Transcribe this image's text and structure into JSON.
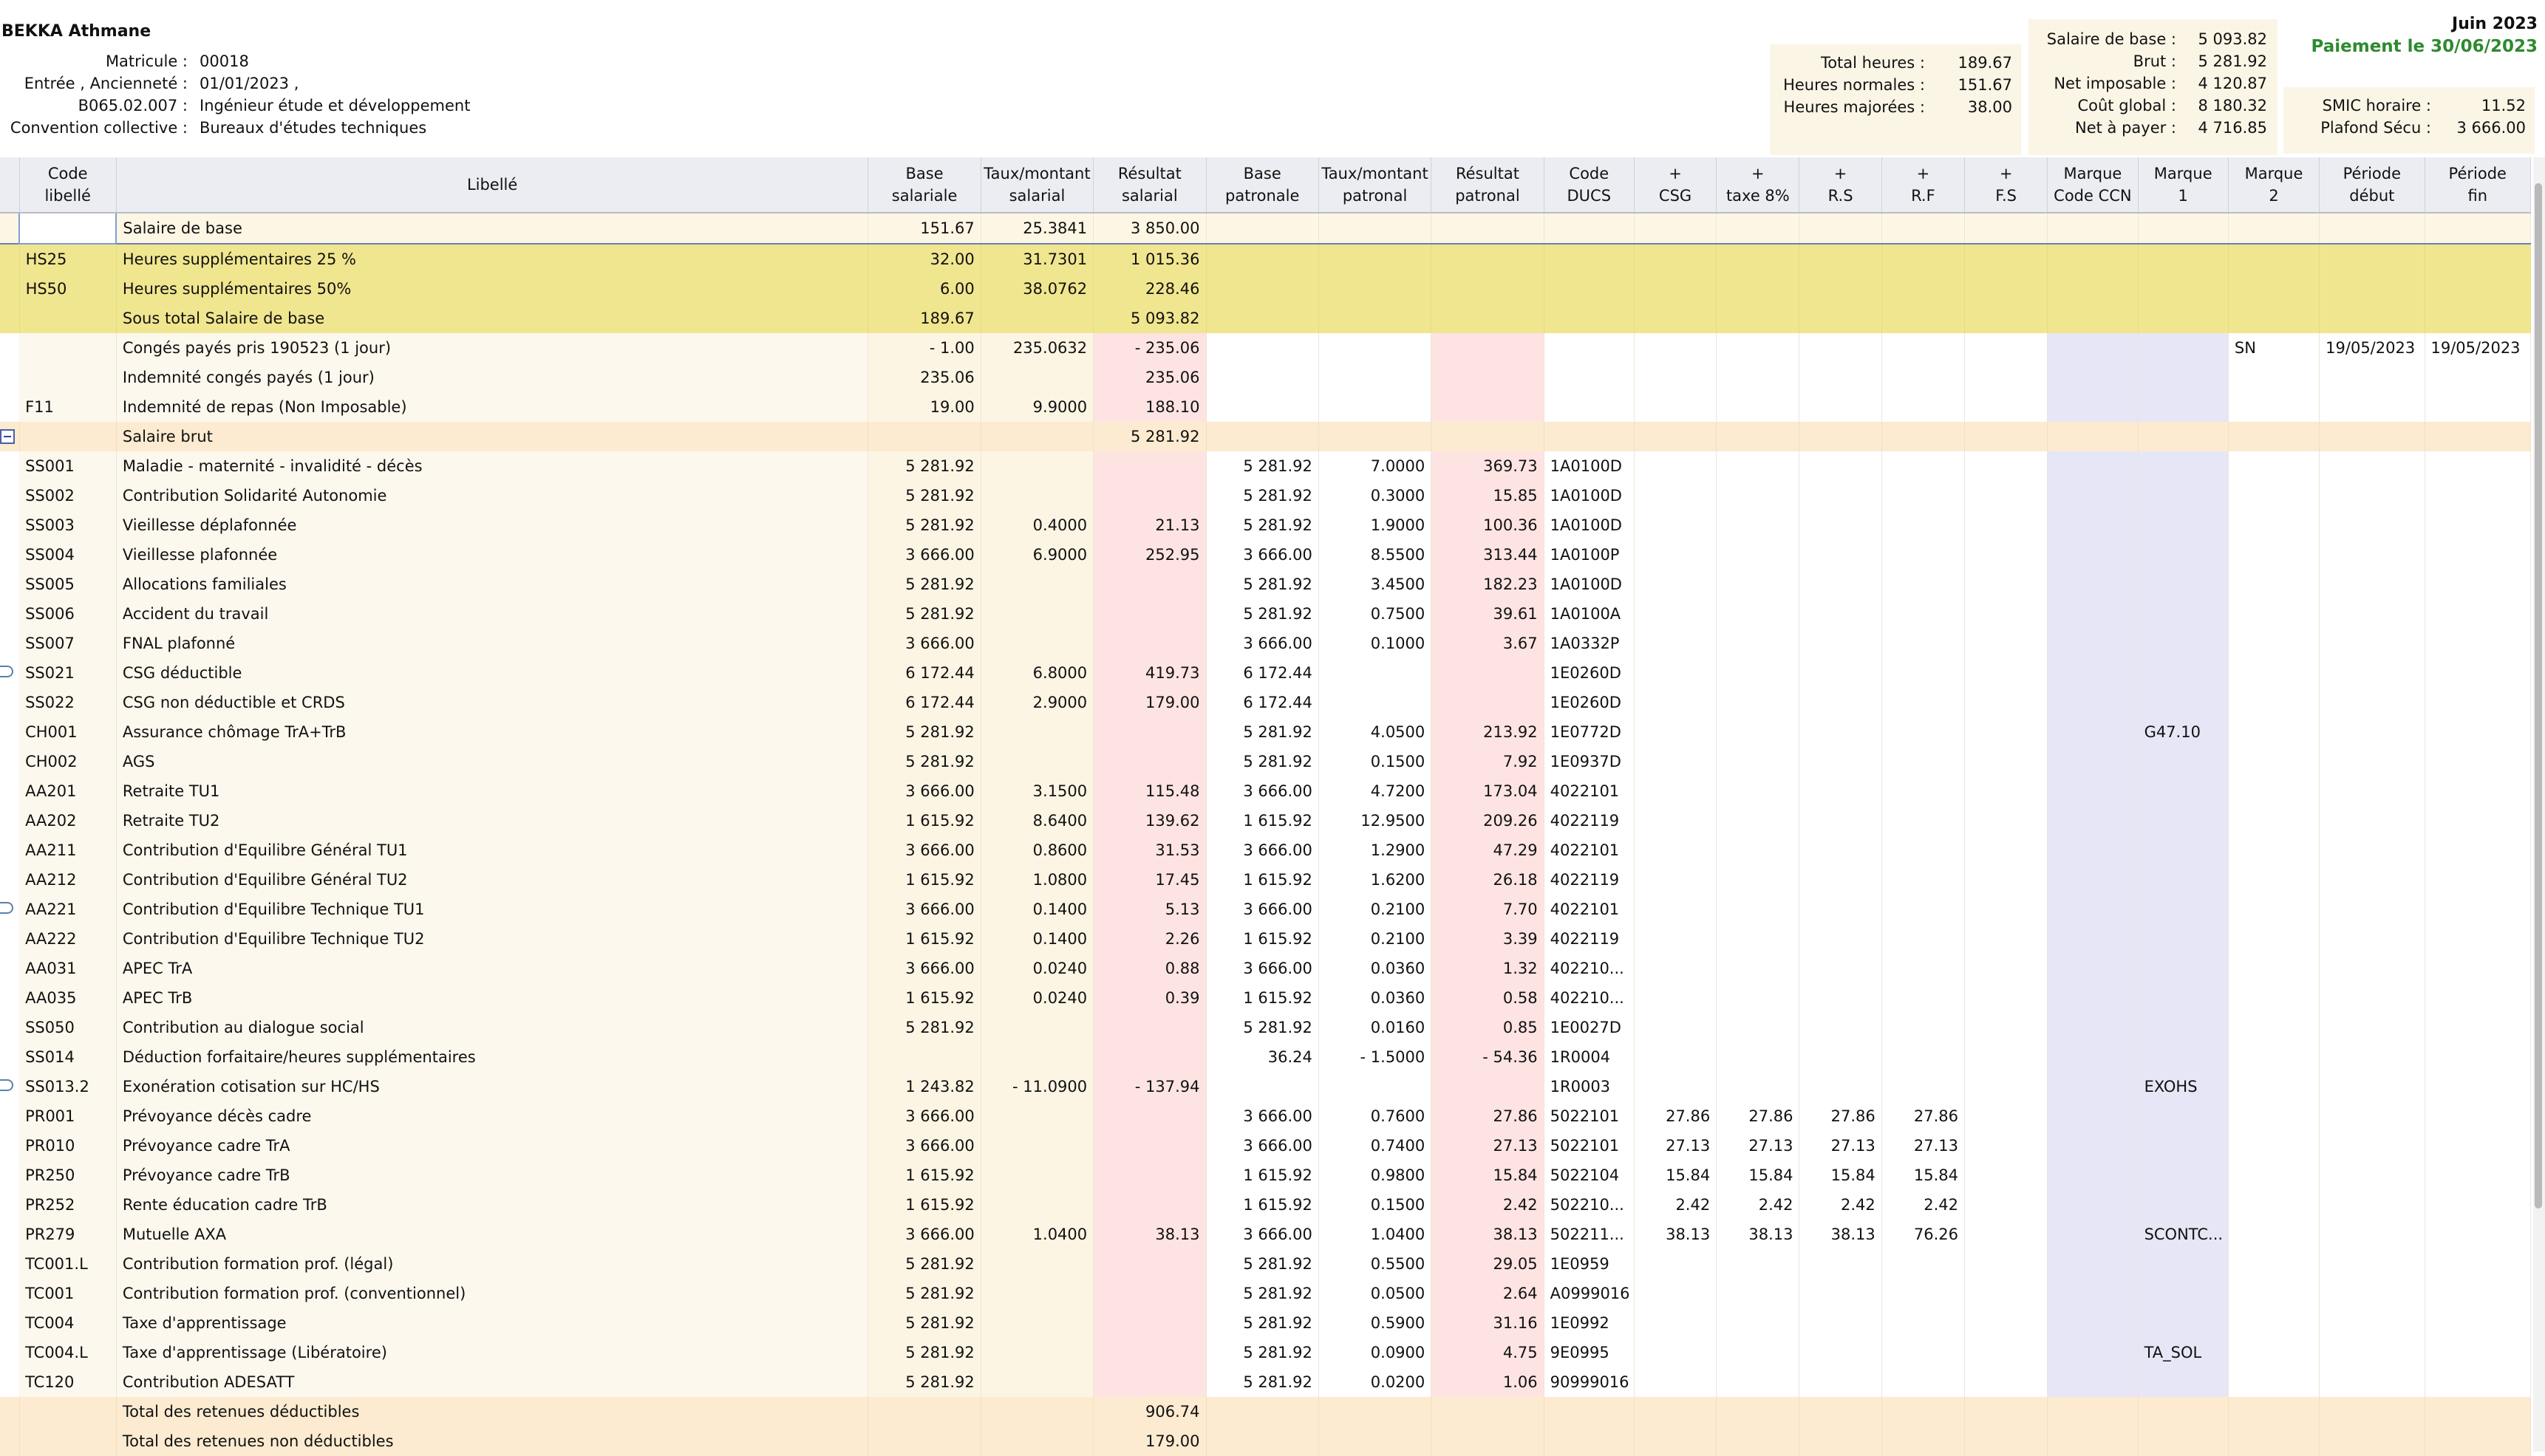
{
  "employee": {
    "name": "BEKKA Athmane",
    "rows": [
      {
        "label": "Matricule :",
        "value": "00018"
      },
      {
        "label": "Entrée , Ancienneté :",
        "value": "01/01/2023  ,"
      },
      {
        "label": "B065.02.007 :",
        "value": "Ingénieur étude et développement"
      },
      {
        "label": "Convention collective :",
        "value": "Bureaux d'études techniques"
      }
    ]
  },
  "hours_box": [
    {
      "label": "Total heures :",
      "value": "189.67"
    },
    {
      "label": "Heures normales :",
      "value": "151.67"
    },
    {
      "label": "Heures majorées :",
      "value": "38.00"
    }
  ],
  "salary_box": [
    {
      "label": "Salaire de base :",
      "value": "5 093.82"
    },
    {
      "label": "Brut :",
      "value": "5 281.92"
    },
    {
      "label": "Net imposable :",
      "value": "4 120.87"
    },
    {
      "label": "Coût global :",
      "value": "8 180.32"
    },
    {
      "label": "Net à payer :",
      "value": "4 716.85"
    }
  ],
  "smic_box": [
    {
      "label": "SMIC horaire :",
      "value": "11.52"
    },
    {
      "label": "Plafond Sécu :",
      "value": "3 666.00"
    }
  ],
  "period": {
    "month": "Juin 2023",
    "payment": "Paiement le 30/06/2023"
  },
  "columns": [
    {
      "l1": "Code",
      "l2": "libellé"
    },
    {
      "l1": "Libellé",
      "l2": ""
    },
    {
      "l1": "Base",
      "l2": "salariale"
    },
    {
      "l1": "Taux/montant",
      "l2": "salarial"
    },
    {
      "l1": "Résultat",
      "l2": "salarial"
    },
    {
      "l1": "Base",
      "l2": "patronale"
    },
    {
      "l1": "Taux/montant",
      "l2": "patronal"
    },
    {
      "l1": "Résultat",
      "l2": "patronal"
    },
    {
      "l1": "Code",
      "l2": "DUCS"
    },
    {
      "l1": "+",
      "l2": "CSG"
    },
    {
      "l1": "+",
      "l2": "taxe 8%"
    },
    {
      "l1": "+",
      "l2": "R.S"
    },
    {
      "l1": "+",
      "l2": "R.F"
    },
    {
      "l1": "+",
      "l2": "F.S"
    },
    {
      "l1": "Marque",
      "l2": "Code CCN"
    },
    {
      "l1": "Marque",
      "l2": "1"
    },
    {
      "l1": "Marque",
      "l2": "2"
    },
    {
      "l1": "Période",
      "l2": "début"
    },
    {
      "l1": "Période",
      "l2": "fin"
    }
  ],
  "rows": [
    {
      "type": "base",
      "marker": "",
      "cells": [
        "",
        "Salaire de base",
        "151.67",
        "25.3841",
        "3 850.00",
        "",
        "",
        "",
        "",
        "",
        "",
        "",
        "",
        "",
        "",
        "",
        "",
        "",
        ""
      ]
    },
    {
      "type": "hs",
      "marker": "",
      "cells": [
        "HS25",
        "Heures supplémentaires 25 %",
        "32.00",
        "31.7301",
        "1 015.36",
        "",
        "",
        "",
        "",
        "",
        "",
        "",
        "",
        "",
        "",
        "",
        "",
        "",
        ""
      ]
    },
    {
      "type": "hs",
      "marker": "",
      "cells": [
        "HS50",
        "Heures supplémentaires 50%",
        "6.00",
        "38.0762",
        "228.46",
        "",
        "",
        "",
        "",
        "",
        "",
        "",
        "",
        "",
        "",
        "",
        "",
        "",
        ""
      ]
    },
    {
      "type": "hs",
      "marker": "",
      "cells": [
        "",
        "Sous total Salaire de base",
        "189.67",
        "",
        "5 093.82",
        "",
        "",
        "",
        "",
        "",
        "",
        "",
        "",
        "",
        "",
        "",
        "",
        "",
        ""
      ]
    },
    {
      "type": "norm",
      "marker": "",
      "cells": [
        "",
        "Congés payés pris 190523 (1 jour)",
        "- 1.00",
        "235.0632",
        "- 235.06",
        "",
        "",
        "",
        "",
        "",
        "",
        "",
        "",
        "",
        "",
        "",
        "SN",
        "19/05/2023",
        "19/05/2023"
      ]
    },
    {
      "type": "norm",
      "marker": "",
      "cells": [
        "",
        "Indemnité congés payés (1 jour)",
        "235.06",
        "",
        "235.06",
        "",
        "",
        "",
        "",
        "",
        "",
        "",
        "",
        "",
        "",
        "",
        "",
        "",
        ""
      ]
    },
    {
      "type": "norm",
      "marker": "",
      "cells": [
        "F11",
        "Indemnité de repas (Non Imposable)",
        "19.00",
        "9.9000",
        "188.10",
        "",
        "",
        "",
        "",
        "",
        "",
        "",
        "",
        "",
        "",
        "",
        "",
        "",
        ""
      ]
    },
    {
      "type": "brut",
      "marker": "minus",
      "cells": [
        "",
        "Salaire brut",
        "",
        "",
        "5 281.92",
        "",
        "",
        "",
        "",
        "",
        "",
        "",
        "",
        "",
        "",
        "",
        "",
        "",
        ""
      ]
    },
    {
      "type": "norm",
      "marker": "",
      "cells": [
        "SS001",
        "Maladie - maternité - invalidité - décès",
        "5 281.92",
        "",
        "",
        "5 281.92",
        "7.0000",
        "369.73",
        "1A0100D",
        "",
        "",
        "",
        "",
        "",
        "",
        "",
        "",
        "",
        ""
      ]
    },
    {
      "type": "norm",
      "marker": "",
      "cells": [
        "SS002",
        "Contribution Solidarité Autonomie",
        "5 281.92",
        "",
        "",
        "5 281.92",
        "0.3000",
        "15.85",
        "1A0100D",
        "",
        "",
        "",
        "",
        "",
        "",
        "",
        "",
        "",
        ""
      ]
    },
    {
      "type": "norm",
      "marker": "",
      "cells": [
        "SS003",
        "Vieillesse déplafonnée",
        "5 281.92",
        "0.4000",
        "21.13",
        "5 281.92",
        "1.9000",
        "100.36",
        "1A0100D",
        "",
        "",
        "",
        "",
        "",
        "",
        "",
        "",
        "",
        ""
      ]
    },
    {
      "type": "norm",
      "marker": "",
      "cells": [
        "SS004",
        "Vieillesse plafonnée",
        "3 666.00",
        "6.9000",
        "252.95",
        "3 666.00",
        "8.5500",
        "313.44",
        "1A0100P",
        "",
        "",
        "",
        "",
        "",
        "",
        "",
        "",
        "",
        ""
      ]
    },
    {
      "type": "norm",
      "marker": "",
      "cells": [
        "SS005",
        "Allocations familiales",
        "5 281.92",
        "",
        "",
        "5 281.92",
        "3.4500",
        "182.23",
        "1A0100D",
        "",
        "",
        "",
        "",
        "",
        "",
        "",
        "",
        "",
        ""
      ]
    },
    {
      "type": "norm",
      "marker": "",
      "cells": [
        "SS006",
        "Accident du travail",
        "5 281.92",
        "",
        "",
        "5 281.92",
        "0.7500",
        "39.61",
        "1A0100A",
        "",
        "",
        "",
        "",
        "",
        "",
        "",
        "",
        "",
        ""
      ]
    },
    {
      "type": "norm",
      "marker": "",
      "cells": [
        "SS007",
        "FNAL plafonné",
        "3 666.00",
        "",
        "",
        "3 666.00",
        "0.1000",
        "3.67",
        "1A0332P",
        "",
        "",
        "",
        "",
        "",
        "",
        "",
        "",
        "",
        ""
      ]
    },
    {
      "type": "norm",
      "marker": "bubble",
      "cells": [
        "SS021",
        "CSG déductible",
        "6 172.44",
        "6.8000",
        "419.73",
        "6 172.44",
        "",
        "",
        "1E0260D",
        "",
        "",
        "",
        "",
        "",
        "",
        "",
        "",
        "",
        ""
      ]
    },
    {
      "type": "norm",
      "marker": "",
      "cells": [
        "SS022",
        "CSG non déductible et CRDS",
        "6 172.44",
        "2.9000",
        "179.00",
        "6 172.44",
        "",
        "",
        "1E0260D",
        "",
        "",
        "",
        "",
        "",
        "",
        "",
        "",
        "",
        ""
      ]
    },
    {
      "type": "norm",
      "marker": "",
      "cells": [
        "CH001",
        "Assurance chômage TrA+TrB",
        "5 281.92",
        "",
        "",
        "5 281.92",
        "4.0500",
        "213.92",
        "1E0772D",
        "",
        "",
        "",
        "",
        "",
        "",
        "G47.10",
        "",
        "",
        ""
      ]
    },
    {
      "type": "norm",
      "marker": "",
      "cells": [
        "CH002",
        "AGS",
        "5 281.92",
        "",
        "",
        "5 281.92",
        "0.1500",
        "7.92",
        "1E0937D",
        "",
        "",
        "",
        "",
        "",
        "",
        "",
        "",
        "",
        ""
      ]
    },
    {
      "type": "norm",
      "marker": "",
      "cells": [
        "AA201",
        "Retraite TU1",
        "3 666.00",
        "3.1500",
        "115.48",
        "3 666.00",
        "4.7200",
        "173.04",
        "4022101",
        "",
        "",
        "",
        "",
        "",
        "",
        "",
        "",
        "",
        ""
      ]
    },
    {
      "type": "norm",
      "marker": "",
      "cells": [
        "AA202",
        "Retraite TU2",
        "1 615.92",
        "8.6400",
        "139.62",
        "1 615.92",
        "12.9500",
        "209.26",
        "4022119",
        "",
        "",
        "",
        "",
        "",
        "",
        "",
        "",
        "",
        ""
      ]
    },
    {
      "type": "norm",
      "marker": "",
      "cells": [
        "AA211",
        "Contribution d'Equilibre Général TU1",
        "3 666.00",
        "0.8600",
        "31.53",
        "3 666.00",
        "1.2900",
        "47.29",
        "4022101",
        "",
        "",
        "",
        "",
        "",
        "",
        "",
        "",
        "",
        ""
      ]
    },
    {
      "type": "norm",
      "marker": "",
      "cells": [
        "AA212",
        "Contribution d'Equilibre Général TU2",
        "1 615.92",
        "1.0800",
        "17.45",
        "1 615.92",
        "1.6200",
        "26.18",
        "4022119",
        "",
        "",
        "",
        "",
        "",
        "",
        "",
        "",
        "",
        ""
      ]
    },
    {
      "type": "norm",
      "marker": "bubble",
      "cells": [
        "AA221",
        "Contribution d'Equilibre Technique TU1",
        "3 666.00",
        "0.1400",
        "5.13",
        "3 666.00",
        "0.2100",
        "7.70",
        "4022101",
        "",
        "",
        "",
        "",
        "",
        "",
        "",
        "",
        "",
        ""
      ]
    },
    {
      "type": "norm",
      "marker": "",
      "cells": [
        "AA222",
        "Contribution d'Equilibre Technique TU2",
        "1 615.92",
        "0.1400",
        "2.26",
        "1 615.92",
        "0.2100",
        "3.39",
        "4022119",
        "",
        "",
        "",
        "",
        "",
        "",
        "",
        "",
        "",
        ""
      ]
    },
    {
      "type": "norm",
      "marker": "",
      "cells": [
        "AA031",
        "APEC TrA",
        "3 666.00",
        "0.0240",
        "0.88",
        "3 666.00",
        "0.0360",
        "1.32",
        "402210...",
        "",
        "",
        "",
        "",
        "",
        "",
        "",
        "",
        "",
        ""
      ]
    },
    {
      "type": "norm",
      "marker": "",
      "cells": [
        "AA035",
        "APEC TrB",
        "1 615.92",
        "0.0240",
        "0.39",
        "1 615.92",
        "0.0360",
        "0.58",
        "402210...",
        "",
        "",
        "",
        "",
        "",
        "",
        "",
        "",
        "",
        ""
      ]
    },
    {
      "type": "norm",
      "marker": "",
      "cells": [
        "SS050",
        "Contribution au dialogue social",
        "5 281.92",
        "",
        "",
        "5 281.92",
        "0.0160",
        "0.85",
        "1E0027D",
        "",
        "",
        "",
        "",
        "",
        "",
        "",
        "",
        "",
        ""
      ]
    },
    {
      "type": "norm",
      "marker": "",
      "cells": [
        "SS014",
        "Déduction forfaitaire/heures supplémentaires",
        "",
        "",
        "",
        "36.24",
        "- 1.5000",
        "- 54.36",
        "1R0004",
        "",
        "",
        "",
        "",
        "",
        "",
        "",
        "",
        "",
        ""
      ]
    },
    {
      "type": "norm",
      "marker": "bubble",
      "cells": [
        "SS013.2",
        "Exonération cotisation sur HC/HS",
        "1 243.82",
        "- 11.0900",
        "- 137.94",
        "",
        "",
        "",
        "1R0003",
        "",
        "",
        "",
        "",
        "",
        "",
        "EXOHS",
        "",
        "",
        ""
      ]
    },
    {
      "type": "norm",
      "marker": "",
      "cells": [
        "PR001",
        "Prévoyance décès cadre",
        "3 666.00",
        "",
        "",
        "3 666.00",
        "0.7600",
        "27.86",
        "5022101",
        "27.86",
        "27.86",
        "27.86",
        "27.86",
        "",
        "",
        "",
        "",
        "",
        ""
      ]
    },
    {
      "type": "norm",
      "marker": "",
      "cells": [
        "PR010",
        "Prévoyance cadre TrA",
        "3 666.00",
        "",
        "",
        "3 666.00",
        "0.7400",
        "27.13",
        "5022101",
        "27.13",
        "27.13",
        "27.13",
        "27.13",
        "",
        "",
        "",
        "",
        "",
        ""
      ]
    },
    {
      "type": "norm",
      "marker": "",
      "cells": [
        "PR250",
        "Prévoyance cadre TrB",
        "1 615.92",
        "",
        "",
        "1 615.92",
        "0.9800",
        "15.84",
        "5022104",
        "15.84",
        "15.84",
        "15.84",
        "15.84",
        "",
        "",
        "",
        "",
        "",
        ""
      ]
    },
    {
      "type": "norm",
      "marker": "",
      "cells": [
        "PR252",
        "Rente éducation cadre TrB",
        "1 615.92",
        "",
        "",
        "1 615.92",
        "0.1500",
        "2.42",
        "502210...",
        "2.42",
        "2.42",
        "2.42",
        "2.42",
        "",
        "",
        "",
        "",
        "",
        ""
      ]
    },
    {
      "type": "norm",
      "marker": "",
      "cells": [
        "PR279",
        "Mutuelle AXA",
        "3 666.00",
        "1.0400",
        "38.13",
        "3 666.00",
        "1.0400",
        "38.13",
        "502211...",
        "38.13",
        "38.13",
        "38.13",
        "76.26",
        "",
        "",
        "SCONTC...",
        "",
        "",
        ""
      ]
    },
    {
      "type": "norm",
      "marker": "",
      "cells": [
        "TC001.L",
        "Contribution formation prof. (légal)",
        "5 281.92",
        "",
        "",
        "5 281.92",
        "0.5500",
        "29.05",
        "1E0959",
        "",
        "",
        "",
        "",
        "",
        "",
        "",
        "",
        "",
        ""
      ]
    },
    {
      "type": "norm",
      "marker": "",
      "cells": [
        "TC001",
        "Contribution formation prof. (conventionnel)",
        "5 281.92",
        "",
        "",
        "5 281.92",
        "0.0500",
        "2.64",
        "A0999016",
        "",
        "",
        "",
        "",
        "",
        "",
        "",
        "",
        "",
        ""
      ]
    },
    {
      "type": "norm",
      "marker": "",
      "cells": [
        "TC004",
        "Taxe d'apprentissage",
        "5 281.92",
        "",
        "",
        "5 281.92",
        "0.5900",
        "31.16",
        "1E0992",
        "",
        "",
        "",
        "",
        "",
        "",
        "",
        "",
        "",
        ""
      ]
    },
    {
      "type": "norm",
      "marker": "",
      "cells": [
        "TC004.L",
        "Taxe d'apprentissage (Libératoire)",
        "5 281.92",
        "",
        "",
        "5 281.92",
        "0.0900",
        "4.75",
        "9E0995",
        "",
        "",
        "",
        "",
        "",
        "",
        "TA_SOL",
        "",
        "",
        ""
      ]
    },
    {
      "type": "norm",
      "marker": "",
      "cells": [
        "TC120",
        "Contribution ADESATT",
        "5 281.92",
        "",
        "",
        "5 281.92",
        "0.0200",
        "1.06",
        "90999016",
        "",
        "",
        "",
        "",
        "",
        "",
        "",
        "",
        "",
        ""
      ]
    },
    {
      "type": "tot",
      "marker": "",
      "cells": [
        "",
        "Total des retenues déductibles",
        "",
        "",
        "906.74",
        "",
        "",
        "",
        "",
        "",
        "",
        "",
        "",
        "",
        "",
        "",
        "",
        "",
        ""
      ]
    },
    {
      "type": "tot",
      "marker": "",
      "cells": [
        "",
        "Total des retenues non déductibles",
        "",
        "",
        "179.00",
        "",
        "",
        "",
        "",
        "",
        "",
        "",
        "",
        "",
        "",
        "",
        "",
        "",
        ""
      ]
    }
  ]
}
